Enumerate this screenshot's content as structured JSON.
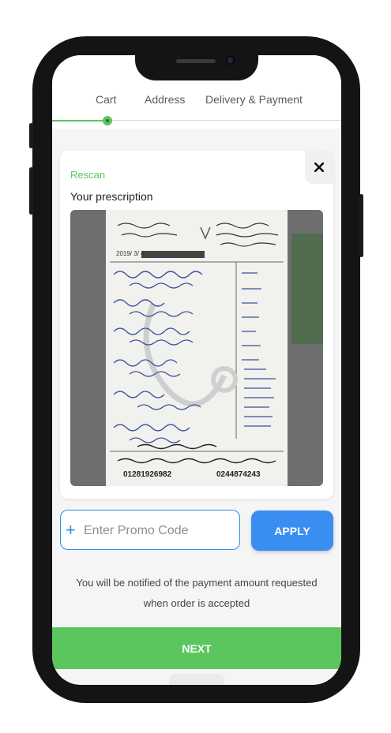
{
  "steps": {
    "cart": "Cart",
    "address": "Address",
    "delivery_payment": "Delivery & Payment"
  },
  "prescription_card": {
    "rescan_label": "Rescan",
    "title": "Your prescription",
    "close_icon": "close-icon",
    "image_alt": "Photographed handwritten prescription"
  },
  "promo": {
    "placeholder": "Enter Promo Code",
    "value": "",
    "apply_label": "APPLY",
    "plus_icon": "plus-icon"
  },
  "notice": "You will be notified of the payment amount requested when order is accepted",
  "next_label": "NEXT",
  "colors": {
    "accent_green": "#5cc65e",
    "accent_blue": "#3a8ef2",
    "background": "#f5f5f5"
  }
}
